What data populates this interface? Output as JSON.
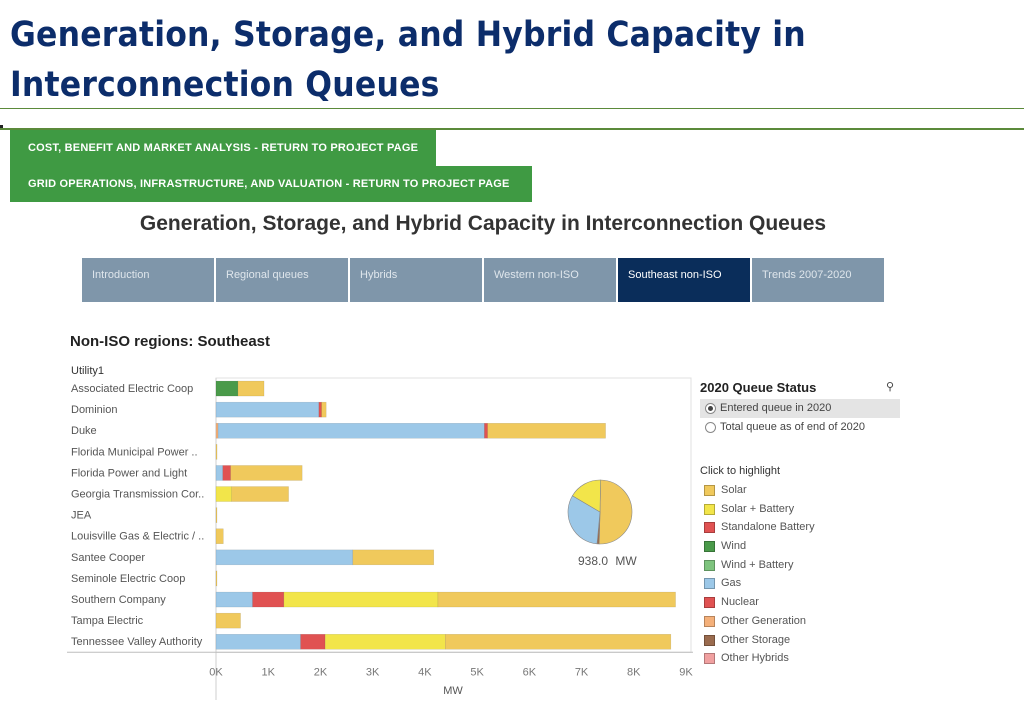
{
  "page": {
    "title": "Generation, Storage, and Hybrid Capacity in Interconnection Queues"
  },
  "links": {
    "cost_benefit": "COST, BENEFIT AND MARKET ANALYSIS - RETURN TO PROJECT PAGE",
    "grid_ops": "GRID OPERATIONS, INFRASTRUCTURE, AND VALUATION - RETURN TO PROJECT PAGE"
  },
  "viz": {
    "title": "Generation, Storage, and Hybrid Capacity in Interconnection Queues",
    "tabs": [
      {
        "label": "Introduction",
        "active": false
      },
      {
        "label": "Regional queues",
        "active": false
      },
      {
        "label": "Hybrids",
        "active": false
      },
      {
        "label": "Western non-ISO",
        "active": false
      },
      {
        "label": "Southeast non-ISO",
        "active": true
      },
      {
        "label": "Trends 2007-2020",
        "active": false
      }
    ],
    "section_title": "Non-ISO regions: Southeast"
  },
  "legend": {
    "status_title": "2020 Queue Status",
    "search_icon": "search-icon",
    "options": [
      {
        "label": "Entered queue in 2020",
        "selected": true
      },
      {
        "label": "Total queue as of end of 2020",
        "selected": false
      }
    ],
    "highlight_label": "Click to highlight",
    "colors": {
      "Solar": "#f0c95c",
      "Solar + Battery": "#f2e54a",
      "Standalone Battery": "#e05252",
      "Wind": "#4a9a4a",
      "Wind + Battery": "#7ec47e",
      "Gas": "#9cc8e8",
      "Nuclear": "#e05252",
      "Other Generation": "#f4b07a",
      "Other Storage": "#9a6b4e",
      "Other Hybrids": "#f0a0a0"
    },
    "items": [
      "Solar",
      "Solar + Battery",
      "Standalone Battery",
      "Wind",
      "Wind + Battery",
      "Gas",
      "Nuclear",
      "Other Generation",
      "Other Storage",
      "Other Hybrids"
    ]
  },
  "chart_data": {
    "type": "bar",
    "orientation": "horizontal",
    "stacked": true,
    "row_header": "Utility1",
    "xlabel": "MW",
    "xlim": [
      0,
      9000
    ],
    "xticks": [
      "0K",
      "1K",
      "2K",
      "3K",
      "4K",
      "5K",
      "6K",
      "7K",
      "8K",
      "9K"
    ],
    "categories": [
      "Associated Electric Coop",
      "Dominion",
      "Duke",
      "Florida Municipal Power ..",
      "Florida Power and Light",
      "Georgia Transmission Cor..",
      "JEA",
      "Louisville Gas & Electric / ..",
      "Santee Cooper",
      "Seminole Electric Coop",
      "Southern Company",
      "Tampa Electric",
      "Tennessee Valley Authority"
    ],
    "series": [
      {
        "name": "Other Generation",
        "values": [
          0,
          0,
          40,
          0,
          0,
          0,
          0,
          0,
          0,
          0,
          0,
          0,
          0
        ]
      },
      {
        "name": "Wind",
        "values": [
          420,
          0,
          0,
          0,
          0,
          0,
          0,
          0,
          0,
          0,
          0,
          0,
          0
        ]
      },
      {
        "name": "Gas",
        "values": [
          0,
          1970,
          5100,
          0,
          130,
          0,
          0,
          0,
          2620,
          0,
          700,
          0,
          1620
        ]
      },
      {
        "name": "Standalone Battery",
        "values": [
          0,
          50,
          60,
          0,
          150,
          0,
          0,
          0,
          0,
          0,
          600,
          0,
          470
        ]
      },
      {
        "name": "Solar + Battery",
        "values": [
          0,
          0,
          0,
          0,
          0,
          300,
          0,
          0,
          0,
          0,
          2950,
          0,
          2300
        ]
      },
      {
        "name": "Solar",
        "values": [
          500,
          90,
          2260,
          20,
          1370,
          1090,
          10,
          140,
          1550,
          10,
          4550,
          470,
          4320
        ]
      }
    ],
    "pie": {
      "total_label": "938.0",
      "unit": "MW",
      "slices": [
        {
          "name": "Solar",
          "value": 470
        },
        {
          "name": "Other Storage",
          "value": 10
        },
        {
          "name": "Gas",
          "value": 300
        },
        {
          "name": "Solar + Battery",
          "value": 158
        }
      ]
    }
  }
}
